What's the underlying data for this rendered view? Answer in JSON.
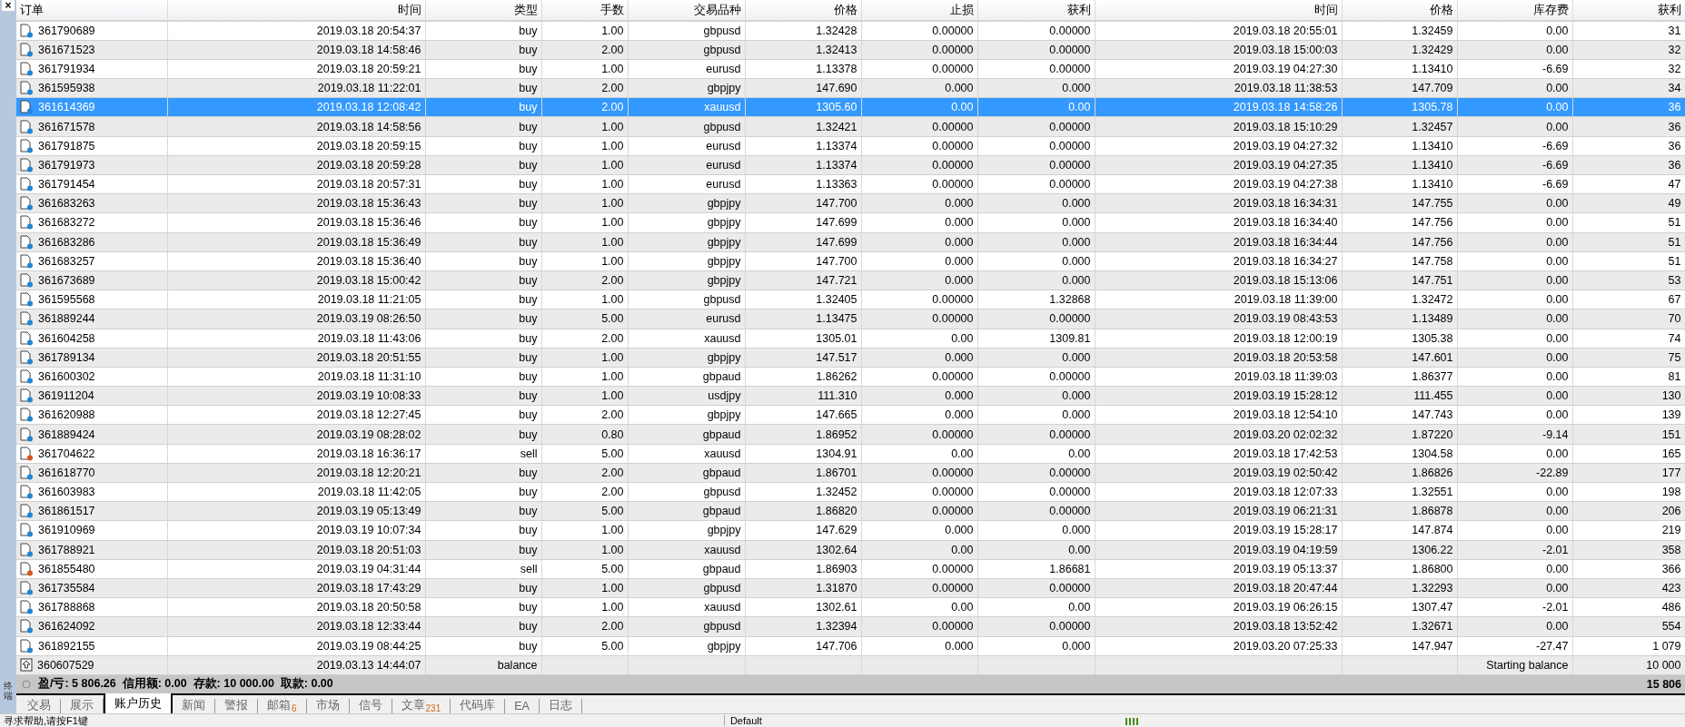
{
  "panel": {
    "close": "×",
    "side_label": "终端"
  },
  "table": {
    "columns": [
      "订单",
      "时间",
      "类型",
      "手数",
      "交易品种",
      "价格",
      "止损",
      "获利",
      "时间",
      "价格",
      "库存费",
      "获利"
    ],
    "rows": [
      {
        "kind": "buy",
        "selected": false,
        "cells": [
          "361790689",
          "2019.03.18 20:54:37",
          "buy",
          "1.00",
          "gbpusd",
          "1.32428",
          "0.00000",
          "0.00000",
          "2019.03.18 20:55:01",
          "1.32459",
          "0.00",
          "31"
        ]
      },
      {
        "kind": "buy",
        "selected": false,
        "cells": [
          "361671523",
          "2019.03.18 14:58:46",
          "buy",
          "2.00",
          "gbpusd",
          "1.32413",
          "0.00000",
          "0.00000",
          "2019.03.18 15:00:03",
          "1.32429",
          "0.00",
          "32"
        ]
      },
      {
        "kind": "buy",
        "selected": false,
        "cells": [
          "361791934",
          "2019.03.18 20:59:21",
          "buy",
          "1.00",
          "eurusd",
          "1.13378",
          "0.00000",
          "0.00000",
          "2019.03.19 04:27:30",
          "1.13410",
          "-6.69",
          "32"
        ]
      },
      {
        "kind": "buy",
        "selected": false,
        "cells": [
          "361595938",
          "2019.03.18 11:22:01",
          "buy",
          "2.00",
          "gbpjpy",
          "147.690",
          "0.000",
          "0.000",
          "2019.03.18 11:38:53",
          "147.709",
          "0.00",
          "34"
        ]
      },
      {
        "kind": "buy",
        "selected": true,
        "cells": [
          "361614369",
          "2019.03.18 12:08:42",
          "buy",
          "2.00",
          "xauusd",
          "1305.60",
          "0.00",
          "0.00",
          "2019.03.18 14:58:26",
          "1305.78",
          "0.00",
          "36"
        ]
      },
      {
        "kind": "buy",
        "selected": false,
        "cells": [
          "361671578",
          "2019.03.18 14:58:56",
          "buy",
          "1.00",
          "gbpusd",
          "1.32421",
          "0.00000",
          "0.00000",
          "2019.03.18 15:10:29",
          "1.32457",
          "0.00",
          "36"
        ]
      },
      {
        "kind": "buy",
        "selected": false,
        "cells": [
          "361791875",
          "2019.03.18 20:59:15",
          "buy",
          "1.00",
          "eurusd",
          "1.13374",
          "0.00000",
          "0.00000",
          "2019.03.19 04:27:32",
          "1.13410",
          "-6.69",
          "36"
        ]
      },
      {
        "kind": "buy",
        "selected": false,
        "cells": [
          "361791973",
          "2019.03.18 20:59:28",
          "buy",
          "1.00",
          "eurusd",
          "1.13374",
          "0.00000",
          "0.00000",
          "2019.03.19 04:27:35",
          "1.13410",
          "-6.69",
          "36"
        ]
      },
      {
        "kind": "buy",
        "selected": false,
        "cells": [
          "361791454",
          "2019.03.18 20:57:31",
          "buy",
          "1.00",
          "eurusd",
          "1.13363",
          "0.00000",
          "0.00000",
          "2019.03.19 04:27:38",
          "1.13410",
          "-6.69",
          "47"
        ]
      },
      {
        "kind": "buy",
        "selected": false,
        "cells": [
          "361683263",
          "2019.03.18 15:36:43",
          "buy",
          "1.00",
          "gbpjpy",
          "147.700",
          "0.000",
          "0.000",
          "2019.03.18 16:34:31",
          "147.755",
          "0.00",
          "49"
        ]
      },
      {
        "kind": "buy",
        "selected": false,
        "cells": [
          "361683272",
          "2019.03.18 15:36:46",
          "buy",
          "1.00",
          "gbpjpy",
          "147.699",
          "0.000",
          "0.000",
          "2019.03.18 16:34:40",
          "147.756",
          "0.00",
          "51"
        ]
      },
      {
        "kind": "buy",
        "selected": false,
        "cells": [
          "361683286",
          "2019.03.18 15:36:49",
          "buy",
          "1.00",
          "gbpjpy",
          "147.699",
          "0.000",
          "0.000",
          "2019.03.18 16:34:44",
          "147.756",
          "0.00",
          "51"
        ]
      },
      {
        "kind": "buy",
        "selected": false,
        "cells": [
          "361683257",
          "2019.03.18 15:36:40",
          "buy",
          "1.00",
          "gbpjpy",
          "147.700",
          "0.000",
          "0.000",
          "2019.03.18 16:34:27",
          "147.758",
          "0.00",
          "51"
        ]
      },
      {
        "kind": "buy",
        "selected": false,
        "cells": [
          "361673689",
          "2019.03.18 15:00:42",
          "buy",
          "2.00",
          "gbpjpy",
          "147.721",
          "0.000",
          "0.000",
          "2019.03.18 15:13:06",
          "147.751",
          "0.00",
          "53"
        ]
      },
      {
        "kind": "buy",
        "selected": false,
        "cells": [
          "361595568",
          "2019.03.18 11:21:05",
          "buy",
          "1.00",
          "gbpusd",
          "1.32405",
          "0.00000",
          "1.32868",
          "2019.03.18 11:39:00",
          "1.32472",
          "0.00",
          "67"
        ]
      },
      {
        "kind": "buy",
        "selected": false,
        "cells": [
          "361889244",
          "2019.03.19 08:26:50",
          "buy",
          "5.00",
          "eurusd",
          "1.13475",
          "0.00000",
          "0.00000",
          "2019.03.19 08:43:53",
          "1.13489",
          "0.00",
          "70"
        ]
      },
      {
        "kind": "buy",
        "selected": false,
        "cells": [
          "361604258",
          "2019.03.18 11:43:06",
          "buy",
          "2.00",
          "xauusd",
          "1305.01",
          "0.00",
          "1309.81",
          "2019.03.18 12:00:19",
          "1305.38",
          "0.00",
          "74"
        ]
      },
      {
        "kind": "buy",
        "selected": false,
        "cells": [
          "361789134",
          "2019.03.18 20:51:55",
          "buy",
          "1.00",
          "gbpjpy",
          "147.517",
          "0.000",
          "0.000",
          "2019.03.18 20:53:58",
          "147.601",
          "0.00",
          "75"
        ]
      },
      {
        "kind": "buy",
        "selected": false,
        "cells": [
          "361600302",
          "2019.03.18 11:31:10",
          "buy",
          "1.00",
          "gbpaud",
          "1.86262",
          "0.00000",
          "0.00000",
          "2019.03.18 11:39:03",
          "1.86377",
          "0.00",
          "81"
        ]
      },
      {
        "kind": "buy",
        "selected": false,
        "cells": [
          "361911204",
          "2019.03.19 10:08:33",
          "buy",
          "1.00",
          "usdjpy",
          "111.310",
          "0.000",
          "0.000",
          "2019.03.19 15:28:12",
          "111.455",
          "0.00",
          "130"
        ]
      },
      {
        "kind": "buy",
        "selected": false,
        "cells": [
          "361620988",
          "2019.03.18 12:27:45",
          "buy",
          "2.00",
          "gbpjpy",
          "147.665",
          "0.000",
          "0.000",
          "2019.03.18 12:54:10",
          "147.743",
          "0.00",
          "139"
        ]
      },
      {
        "kind": "buy",
        "selected": false,
        "cells": [
          "361889424",
          "2019.03.19 08:28:02",
          "buy",
          "0.80",
          "gbpaud",
          "1.86952",
          "0.00000",
          "0.00000",
          "2019.03.20 02:02:32",
          "1.87220",
          "-9.14",
          "151"
        ]
      },
      {
        "kind": "sell",
        "selected": false,
        "cells": [
          "361704622",
          "2019.03.18 16:36:17",
          "sell",
          "5.00",
          "xauusd",
          "1304.91",
          "0.00",
          "0.00",
          "2019.03.18 17:42:53",
          "1304.58",
          "0.00",
          "165"
        ]
      },
      {
        "kind": "buy",
        "selected": false,
        "cells": [
          "361618770",
          "2019.03.18 12:20:21",
          "buy",
          "2.00",
          "gbpaud",
          "1.86701",
          "0.00000",
          "0.00000",
          "2019.03.19 02:50:42",
          "1.86826",
          "-22.89",
          "177"
        ]
      },
      {
        "kind": "buy",
        "selected": false,
        "cells": [
          "361603983",
          "2019.03.18 11:42:05",
          "buy",
          "2.00",
          "gbpusd",
          "1.32452",
          "0.00000",
          "0.00000",
          "2019.03.18 12:07:33",
          "1.32551",
          "0.00",
          "198"
        ]
      },
      {
        "kind": "buy",
        "selected": false,
        "cells": [
          "361861517",
          "2019.03.19 05:13:49",
          "buy",
          "5.00",
          "gbpaud",
          "1.86820",
          "0.00000",
          "0.00000",
          "2019.03.19 06:21:31",
          "1.86878",
          "0.00",
          "206"
        ]
      },
      {
        "kind": "buy",
        "selected": false,
        "cells": [
          "361910969",
          "2019.03.19 10:07:34",
          "buy",
          "1.00",
          "gbpjpy",
          "147.629",
          "0.000",
          "0.000",
          "2019.03.19 15:28:17",
          "147.874",
          "0.00",
          "219"
        ]
      },
      {
        "kind": "buy",
        "selected": false,
        "cells": [
          "361788921",
          "2019.03.18 20:51:03",
          "buy",
          "1.00",
          "xauusd",
          "1302.64",
          "0.00",
          "0.00",
          "2019.03.19 04:19:59",
          "1306.22",
          "-2.01",
          "358"
        ]
      },
      {
        "kind": "sell",
        "selected": false,
        "cells": [
          "361855480",
          "2019.03.19 04:31:44",
          "sell",
          "5.00",
          "gbpaud",
          "1.86903",
          "0.00000",
          "1.86681",
          "2019.03.19 05:13:37",
          "1.86800",
          "0.00",
          "366"
        ]
      },
      {
        "kind": "buy",
        "selected": false,
        "cells": [
          "361735584",
          "2019.03.18 17:43:29",
          "buy",
          "1.00",
          "gbpusd",
          "1.31870",
          "0.00000",
          "0.00000",
          "2019.03.18 20:47:44",
          "1.32293",
          "0.00",
          "423"
        ]
      },
      {
        "kind": "buy",
        "selected": false,
        "cells": [
          "361788868",
          "2019.03.18 20:50:58",
          "buy",
          "1.00",
          "xauusd",
          "1302.61",
          "0.00",
          "0.00",
          "2019.03.19 06:26:15",
          "1307.47",
          "-2.01",
          "486"
        ]
      },
      {
        "kind": "buy",
        "selected": false,
        "cells": [
          "361624092",
          "2019.03.18 12:33:44",
          "buy",
          "2.00",
          "gbpusd",
          "1.32394",
          "0.00000",
          "0.00000",
          "2019.03.18 13:52:42",
          "1.32671",
          "0.00",
          "554"
        ]
      },
      {
        "kind": "buy",
        "selected": false,
        "cells": [
          "361892155",
          "2019.03.19 08:44:25",
          "buy",
          "5.00",
          "gbpjpy",
          "147.706",
          "0.000",
          "0.000",
          "2019.03.20 07:25:33",
          "147.947",
          "-27.47",
          "1 079"
        ]
      },
      {
        "kind": "balance",
        "selected": false,
        "cells": [
          "360607529",
          "2019.03.13 14:44:07",
          "balance"
        ],
        "comment": "Starting balance",
        "profit": "10 000"
      }
    ],
    "summary": {
      "text": "盈/亏: 5 806.26  信用额: 0.00  存款: 10 000.00  取款: 0.00",
      "total": "15 806"
    }
  },
  "tabs": [
    {
      "label": "交易",
      "selected": false
    },
    {
      "label": "展示",
      "selected": false
    },
    {
      "label": "账户历史",
      "selected": true
    },
    {
      "label": "新闻",
      "selected": false
    },
    {
      "label": "警报",
      "selected": false
    },
    {
      "label": "邮箱",
      "badge": "6",
      "selected": false
    },
    {
      "label": "市场",
      "selected": false
    },
    {
      "label": "信号",
      "selected": false
    },
    {
      "label": "文章",
      "badge": "231",
      "selected": false
    },
    {
      "label": "代码库",
      "selected": false
    },
    {
      "label": "EA",
      "selected": false
    },
    {
      "label": "日志",
      "selected": false
    }
  ],
  "status_bar": {
    "help": "寻求帮助,请按F1键",
    "profile": "Default"
  }
}
